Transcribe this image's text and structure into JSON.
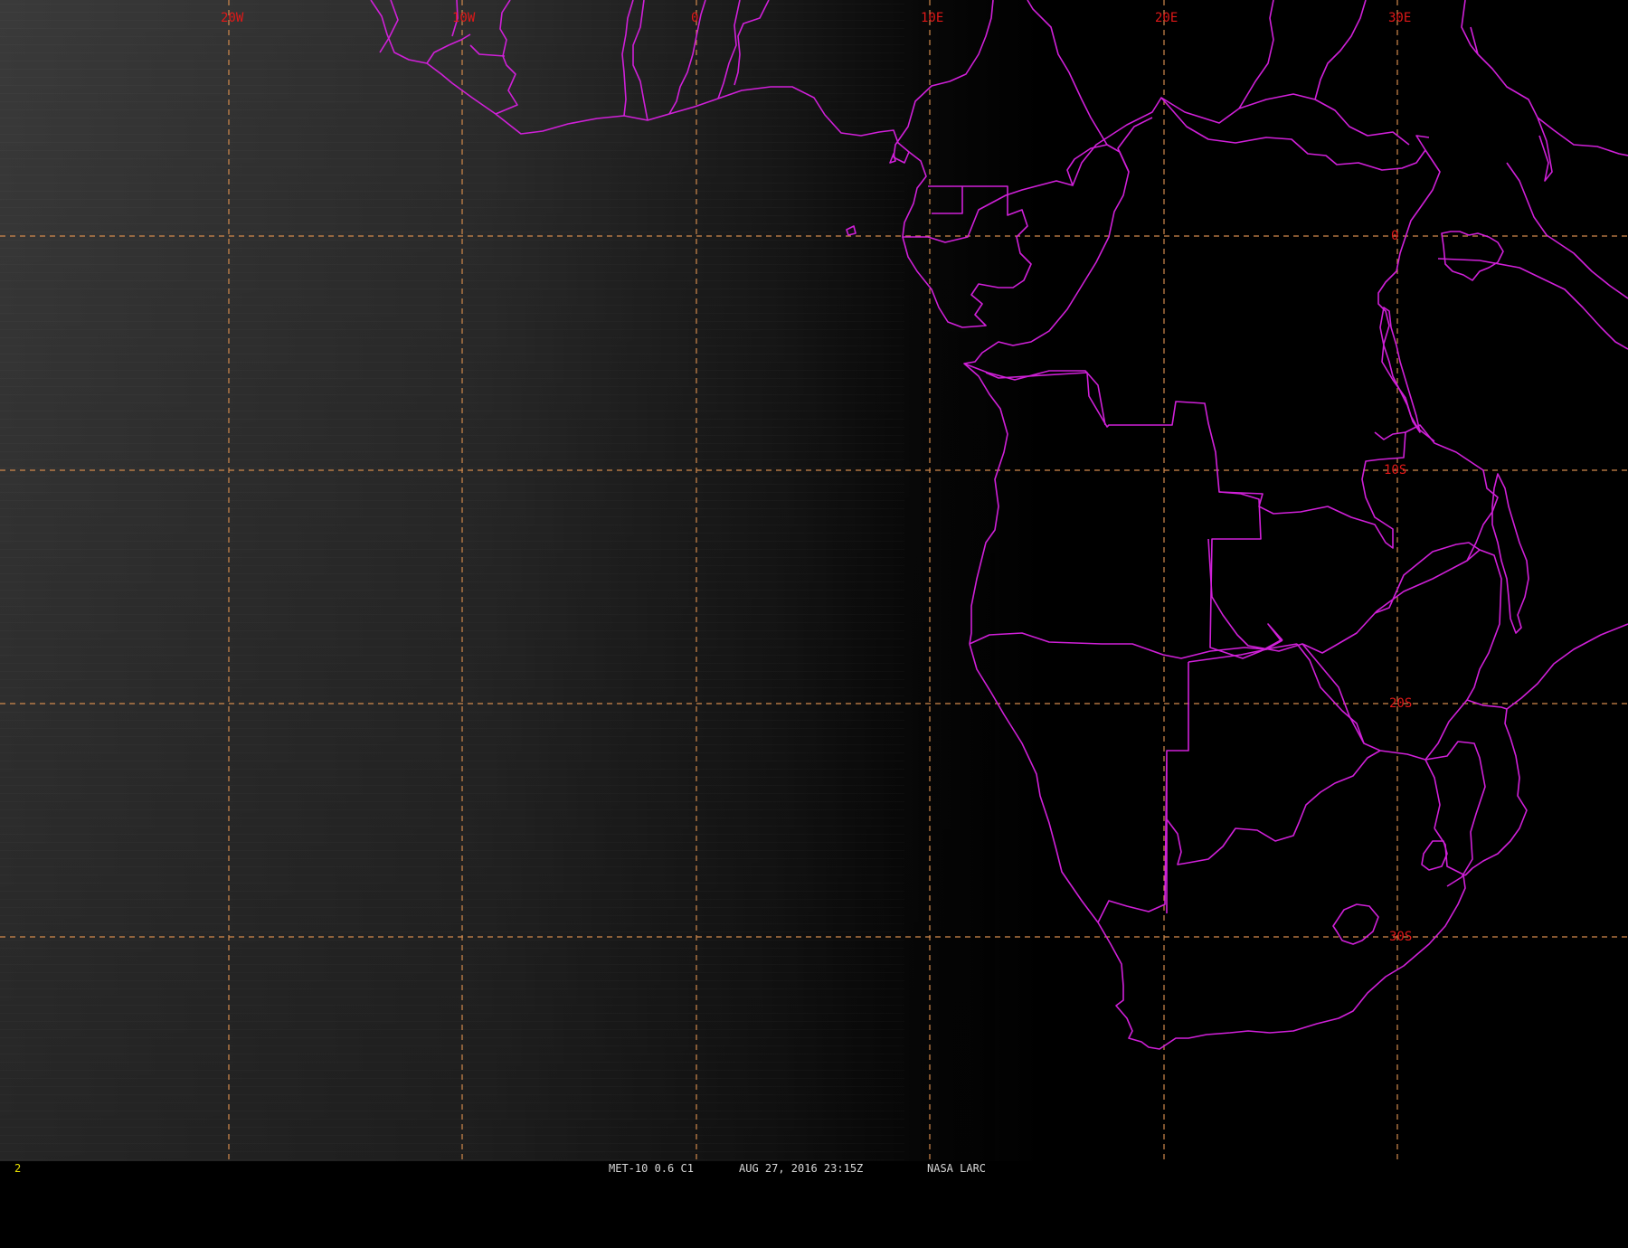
{
  "viewer": {
    "frame_number": "2",
    "satellite_info": "MET-10 0.6 C1",
    "timestamp": "AUG 27, 2016 23:15Z",
    "organization": "NASA LARC",
    "colors": {
      "background": "#000000",
      "grid": "#d38a4c",
      "grid_label": "#e01818",
      "borders": "#d020d8",
      "frame_number": "#e8e000"
    }
  },
  "map": {
    "region": "Western and Southern Africa, South Atlantic Ocean",
    "lon_labels": [
      "20W",
      "10W",
      "0",
      "10E",
      "20E",
      "30E"
    ],
    "lat_labels": [
      "0",
      "10S",
      "20S",
      "30S"
    ]
  }
}
